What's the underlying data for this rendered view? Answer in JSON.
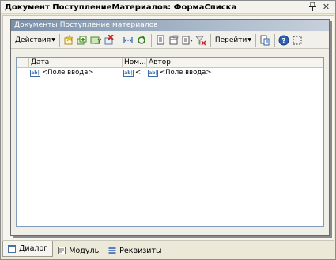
{
  "window": {
    "title": "Документ ПоступлениеМатериалов: ФормаСписка",
    "pin_glyph": "ꟷ",
    "close_glyph": "✕"
  },
  "form": {
    "title": "Документы Поступление материалов"
  },
  "toolbar": {
    "actions_label": "Действия",
    "goto_label": "Перейти",
    "help_glyph": "?",
    "icons": [
      "add-icon",
      "add-copy-icon",
      "add-folder-icon",
      "delete-icon",
      "set-interval-icon",
      "refresh-icon",
      "copy-icon",
      "filter-icon",
      "filter-dropdown-icon",
      "clear-filter-icon",
      "structure-icon",
      "help-icon",
      "fullscreen-icon"
    ]
  },
  "grid": {
    "columns": [
      {
        "label": "Дата"
      },
      {
        "label": "Ном..."
      },
      {
        "label": "Автор"
      }
    ],
    "row": {
      "date": "<Поле ввода>",
      "number": "<",
      "author": "<Поле ввода>"
    },
    "cell_icon_text": "ab|"
  },
  "tabs": [
    {
      "label": "Диалог",
      "icon": "dialog-icon",
      "active": true
    },
    {
      "label": "Модуль",
      "icon": "module-icon",
      "active": false
    },
    {
      "label": "Реквизиты",
      "icon": "attributes-icon",
      "active": false
    }
  ],
  "colors": {
    "form_title_gradient_start": "#7a8fa8",
    "grid_border": "#7f9db9",
    "window_bg": "#ece9d8"
  }
}
